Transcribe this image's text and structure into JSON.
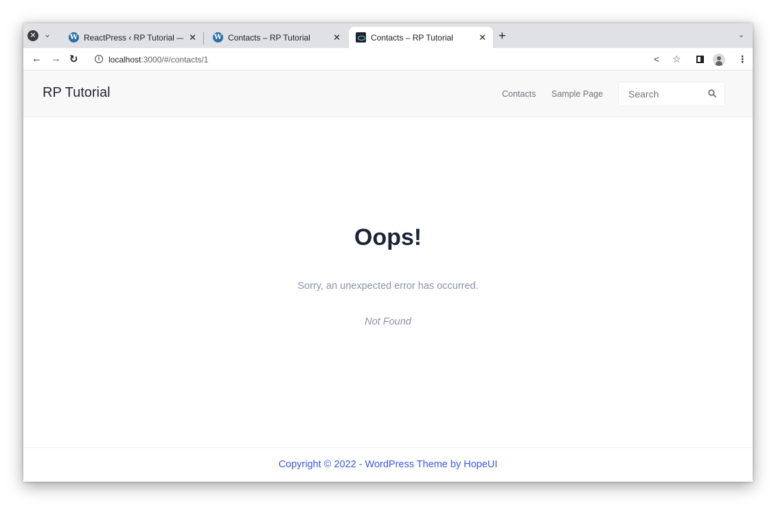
{
  "browser": {
    "tabs": [
      {
        "title": "ReactPress ‹ RP Tutorial — WordPress",
        "icon": "wordpress-icon"
      },
      {
        "title": "Contacts – RP Tutorial",
        "icon": "wordpress-icon"
      },
      {
        "title": "Contacts – RP Tutorial",
        "icon": "react-icon",
        "active": true
      }
    ],
    "url_host": "localhost",
    "url_path": ":3000/#/contacts/1"
  },
  "site": {
    "title": "RP Tutorial",
    "nav": [
      "Contacts",
      "Sample Page"
    ],
    "search_placeholder": "Search"
  },
  "error": {
    "title": "Oops!",
    "message": "Sorry, an unexpected error has occurred.",
    "status": "Not Found"
  },
  "footer": {
    "text": "Copyright © 2022 - WordPress Theme by HopeUI"
  },
  "colors": {
    "accent": "#3a57e8",
    "heading": "#1b2437",
    "muted": "#8a92a6"
  }
}
